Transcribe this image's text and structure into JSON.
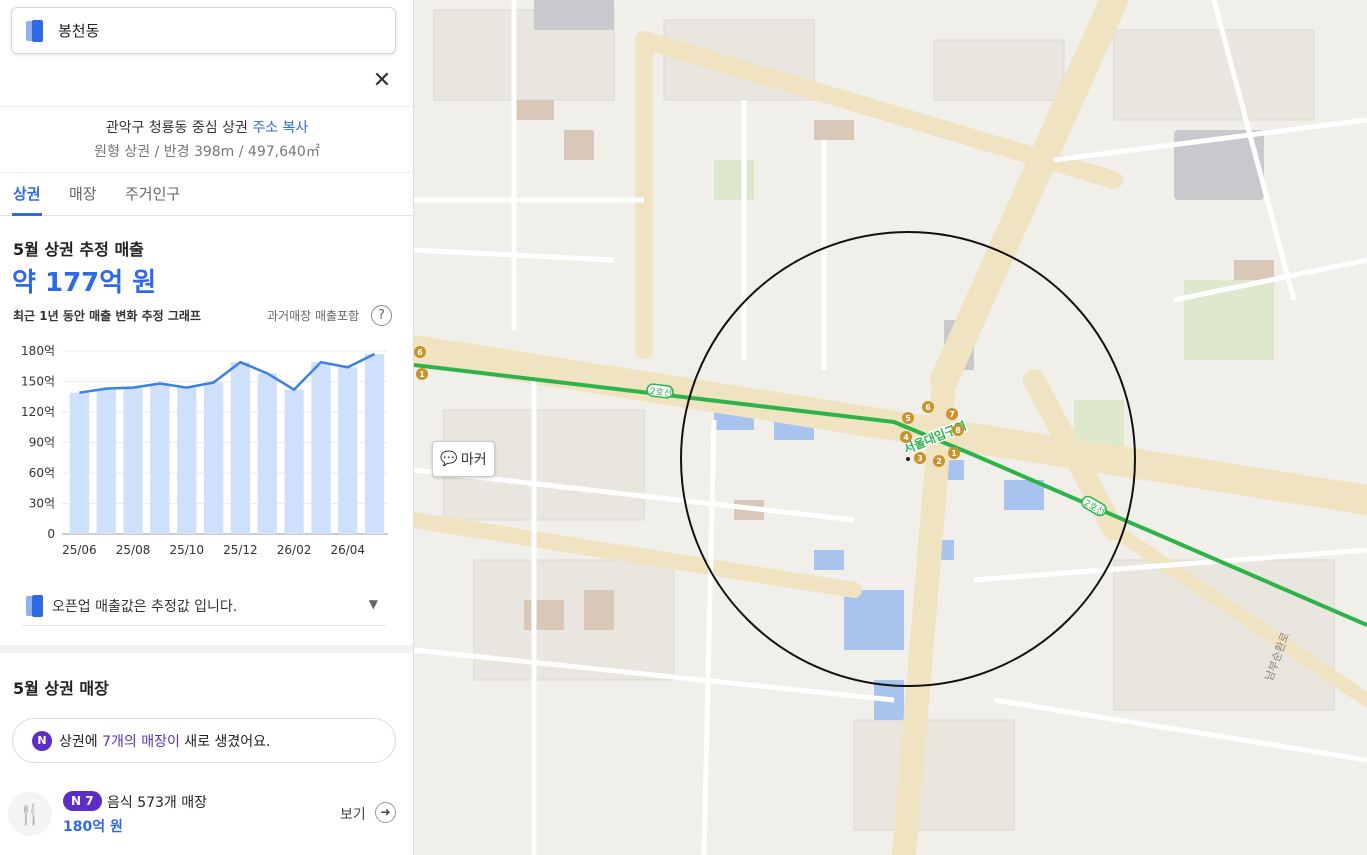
{
  "search": {
    "value": "봉천동"
  },
  "area": {
    "title": "관악구 청룡동 중심 상권",
    "copy_label": "주소 복사",
    "shape_info": "원형 상권 / 반경 398m / 497,640㎡"
  },
  "tabs": [
    {
      "label": "상권",
      "active": true
    },
    {
      "label": "매장",
      "active": false
    },
    {
      "label": "주거인구",
      "active": false
    }
  ],
  "sales": {
    "title": "5월 상권 추정 매출",
    "value": "약 177억 원",
    "graph_label": "최근 1년 동안 매출 변화 추정 그래프",
    "past_label": "과거매장 매출포함",
    "help": "?"
  },
  "chart_data": {
    "type": "bar",
    "overlay": "line",
    "title": "",
    "xlabel": "",
    "ylabel": "",
    "ylim": [
      0,
      180
    ],
    "y_ticks": [
      "0",
      "30억",
      "60억",
      "90억",
      "120억",
      "150억",
      "180억"
    ],
    "x_ticks": [
      "25/06",
      "25/08",
      "25/10",
      "25/12",
      "26/02",
      "26/04"
    ],
    "categories": [
      "25/06",
      "25/07",
      "25/08",
      "25/09",
      "25/10",
      "25/11",
      "25/12",
      "26/01",
      "26/02",
      "26/03",
      "26/04",
      "26/05"
    ],
    "values": [
      139,
      143,
      144,
      148,
      144,
      149,
      169,
      158,
      142,
      169,
      164,
      177
    ],
    "grid": true,
    "colors": {
      "bar": "#cfe0fd",
      "line": "#3f7de8"
    }
  },
  "notice": {
    "text": "오픈업 매출값은 추정값 입니다."
  },
  "stores": {
    "title": "5월 상권 매장",
    "new_badge": "N",
    "new_prefix": "상권에 ",
    "new_highlight": "7개의 매장이",
    "new_suffix": " 새로 생겼어요.",
    "food_badge": "N 7",
    "food_label": "음식 573개 매장",
    "food_amount": "180억 원",
    "view_label": "보기"
  },
  "map": {
    "marker_label": "마커",
    "line_label": "2호선",
    "station_label": "서울대입구역",
    "road_label": "남부순환로",
    "exit_numbers": [
      "1",
      "2",
      "3",
      "4",
      "5",
      "6",
      "7",
      "8"
    ]
  },
  "icons": {
    "logo": "openup-logo-icon",
    "close": "close-icon",
    "help": "help-icon",
    "dropdown": "chevron-down-icon",
    "food": "fork-knife-icon",
    "arrow": "arrow-right-icon",
    "marker": "speech-bubble-icon"
  },
  "colors": {
    "accent": "#2e6ae6",
    "purple": "#5b2fc5",
    "subway": "#2db34a"
  }
}
